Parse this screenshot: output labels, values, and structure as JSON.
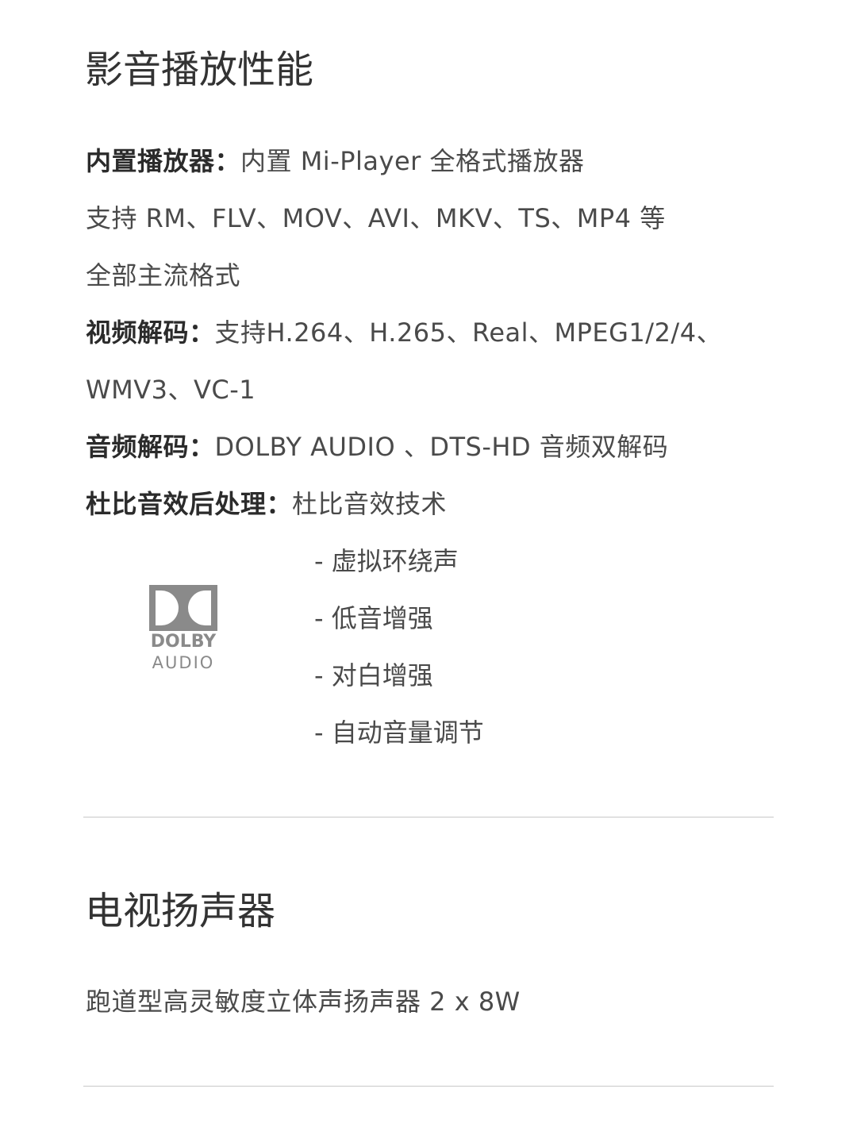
{
  "section1": {
    "title": "影音播放性能",
    "player_label": "内置播放器：",
    "player_value": "内置 Mi-Player 全格式播放器",
    "formats_line1": "支持 RM、FLV、MOV、AVI、MKV、TS、MP4 等",
    "formats_line2": "全部主流格式",
    "video_label": "视频解码：",
    "video_value": "支持H.264、H.265、Real、MPEG1/2/4、",
    "video_value2": "WMV3、VC-1",
    "audio_label": "音频解码：",
    "audio_value": "DOLBY AUDIO 、DTS-HD 音频双解码",
    "dolby_label": "杜比音效后处理：",
    "dolby_value": "杜比音效技术",
    "dolby_features": [
      "- 虚拟环绕声",
      "- 低音增强",
      "- 对白增强",
      "- 自动音量调节"
    ],
    "logo": {
      "word": "DOLBY",
      "sub": "AUDIO",
      "color": "#8a8a8a"
    }
  },
  "section2": {
    "title": "电视扬声器",
    "speaker_text": "跑道型高灵敏度立体声扬声器 2 x 8W"
  },
  "colors": {
    "text": "#4a4a4a",
    "heading": "#333333",
    "divider": "#c8c8c8"
  }
}
